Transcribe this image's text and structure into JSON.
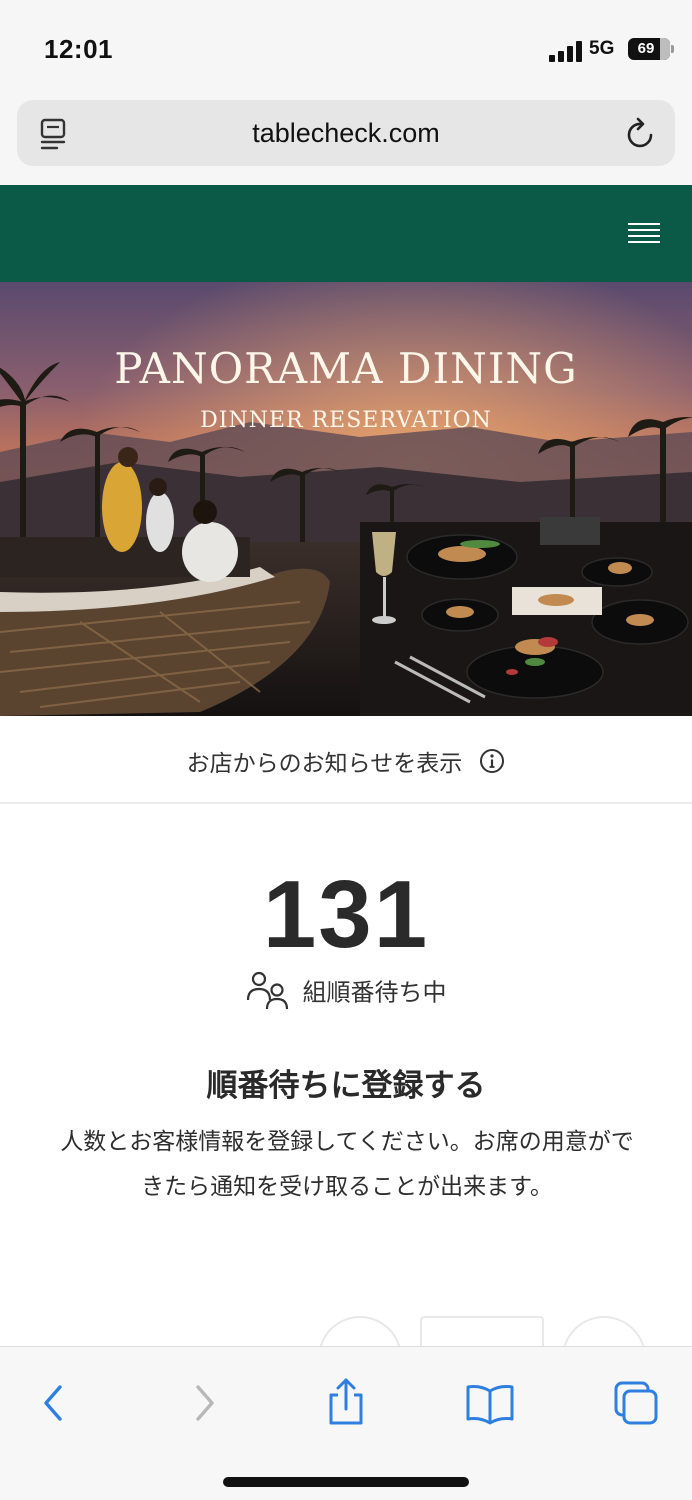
{
  "status_bar": {
    "time": "12:01",
    "network": "5G",
    "battery": "69"
  },
  "browser": {
    "url": "tablecheck.com",
    "icons": [
      "reader-icon",
      "reload-icon"
    ]
  },
  "site_header": {
    "background_color": "#0b5a47",
    "menu_icon": "hamburger-menu-icon"
  },
  "hero": {
    "title": "PANORAMA DINING",
    "subtitle": "DINNER RESERVATION"
  },
  "notice": {
    "label": "お店からのお知らせを表示",
    "icon": "info-icon"
  },
  "queue": {
    "count": "131",
    "label": "組順番待ち中",
    "icon": "people-icon"
  },
  "register": {
    "title": "順番待ちに登録する",
    "description": "人数とお客様情報を登録してください。お席の用意ができたら通知を受け取ることが出来ます。"
  },
  "toolbar": {
    "buttons": [
      "back-icon",
      "forward-icon",
      "share-icon",
      "bookmarks-icon",
      "tabs-icon"
    ],
    "accent_color": "#2f7fe0",
    "disabled_color": "#b8b8b8"
  }
}
